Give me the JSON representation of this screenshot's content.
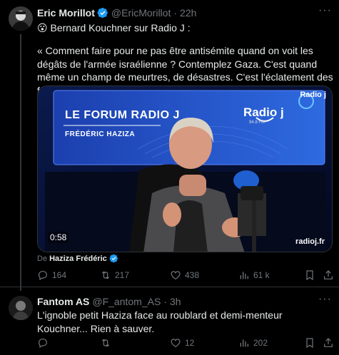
{
  "tweet1": {
    "name": "Eric Morillot",
    "handle": "@EricMorillot",
    "dot": "·",
    "time": "22h",
    "more": "···",
    "line1": "😮 Bernard Kouchner sur Radio J :",
    "quote": "« Comment faire pour ne pas être antisémite quand on voit les dégâts de l'armée israélienne ? Contemplez Gaza. C'est quand même un champ de meurtres, de désastres. C'est l'éclatement des familles. »",
    "media": {
      "forum_title": "LE FORUM RADIO J",
      "forum_subtitle": "FRÉDÉRIC HAZIZA",
      "logo_text": "Radio j",
      "logo_freq": "94.8 FM",
      "watermark_top": "Radio j",
      "watermark_bottom": "radioj.fr",
      "duration": "0:58"
    },
    "credit": {
      "by": "De",
      "name": "Haziza Frédéric"
    },
    "actions": {
      "replies": "164",
      "retweets": "217",
      "likes": "438",
      "views": "61 k"
    }
  },
  "tweet2": {
    "name": "Fantom AS",
    "handle": "@F_antom_AS",
    "dot": "·",
    "time": "3h",
    "more": "···",
    "text": "L'ignoble petit Haziza face au roublard et demi-menteur Kouchner... Rien à sauver.",
    "actions": {
      "replies": "",
      "retweets": "",
      "likes": "12",
      "views": "202"
    }
  },
  "colors": {
    "background": "#000000",
    "text": "#e7e9ea",
    "muted": "#71767b",
    "verified": "#1d9bf0",
    "border": "#2f3336"
  }
}
